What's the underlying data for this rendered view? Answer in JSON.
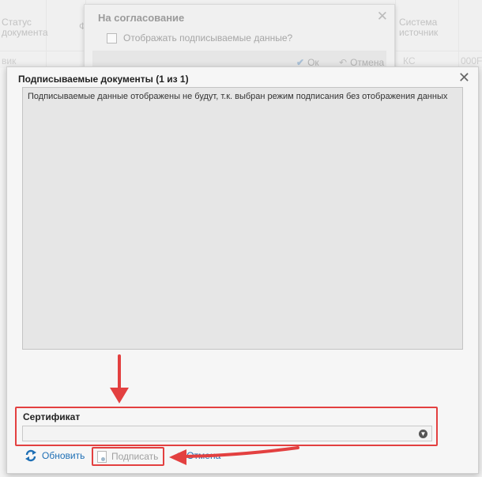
{
  "background": {
    "columns": {
      "status_line1": "Статус",
      "status_line2": "документа",
      "f_partial": "Ф",
      "system_line1": "Система",
      "system_line2": "источник"
    },
    "row": {
      "status_partial": "вик",
      "system_partial": "КС",
      "extra_partial": "000F"
    }
  },
  "back_dialog": {
    "title": "На согласование",
    "show_data_label": "Отображать подписываемые данные?",
    "ok_label": "Ок",
    "cancel_label": "Отмена"
  },
  "dialog": {
    "title": "Подписываемые документы (1 из 1)",
    "message": "Подписываемые данные отображены не будут, т.к. выбран режим подписания без отображения данных",
    "certificate_label": "Сертификат",
    "certificate_value": "",
    "refresh_label": "Обновить",
    "sign_label": "Подписать",
    "cancel_label": "Отмена"
  },
  "colors": {
    "annotation_red": "#e34040",
    "link_blue": "#1e6fb5"
  }
}
